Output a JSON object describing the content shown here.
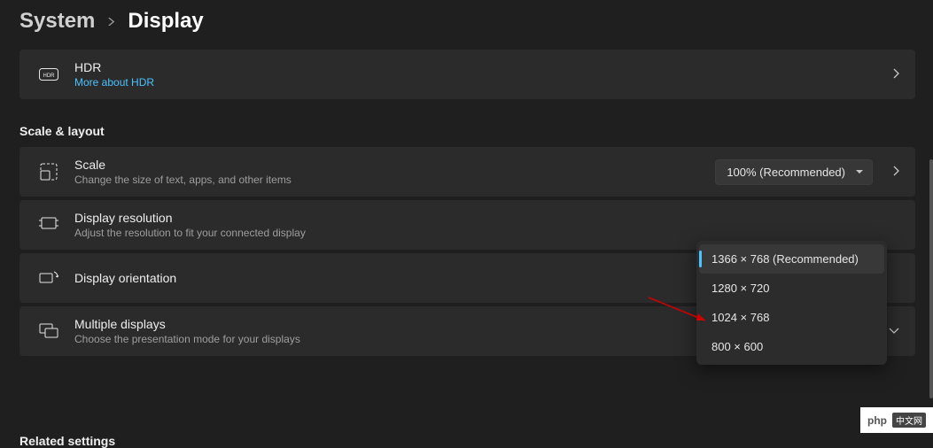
{
  "breadcrumb": {
    "parent": "System",
    "current": "Display"
  },
  "hdr": {
    "title": "HDR",
    "link": "More about HDR",
    "icon": "HDR"
  },
  "section_scale": "Scale & layout",
  "scale": {
    "title": "Scale",
    "subtitle": "Change the size of text, apps, and other items",
    "value": "100% (Recommended)"
  },
  "resolution": {
    "title": "Display resolution",
    "subtitle": "Adjust the resolution to fit your connected display",
    "options": [
      {
        "label": "1366 × 768 (Recommended)",
        "selected": true
      },
      {
        "label": "1280 × 720",
        "selected": false
      },
      {
        "label": "1024 × 768",
        "selected": false
      },
      {
        "label": "800 × 600",
        "selected": false
      }
    ]
  },
  "orientation": {
    "title": "Display orientation"
  },
  "multiple": {
    "title": "Multiple displays",
    "subtitle": "Choose the presentation mode for your displays"
  },
  "related": "Related settings",
  "watermark": {
    "brand": "php",
    "cn": "中文网"
  }
}
